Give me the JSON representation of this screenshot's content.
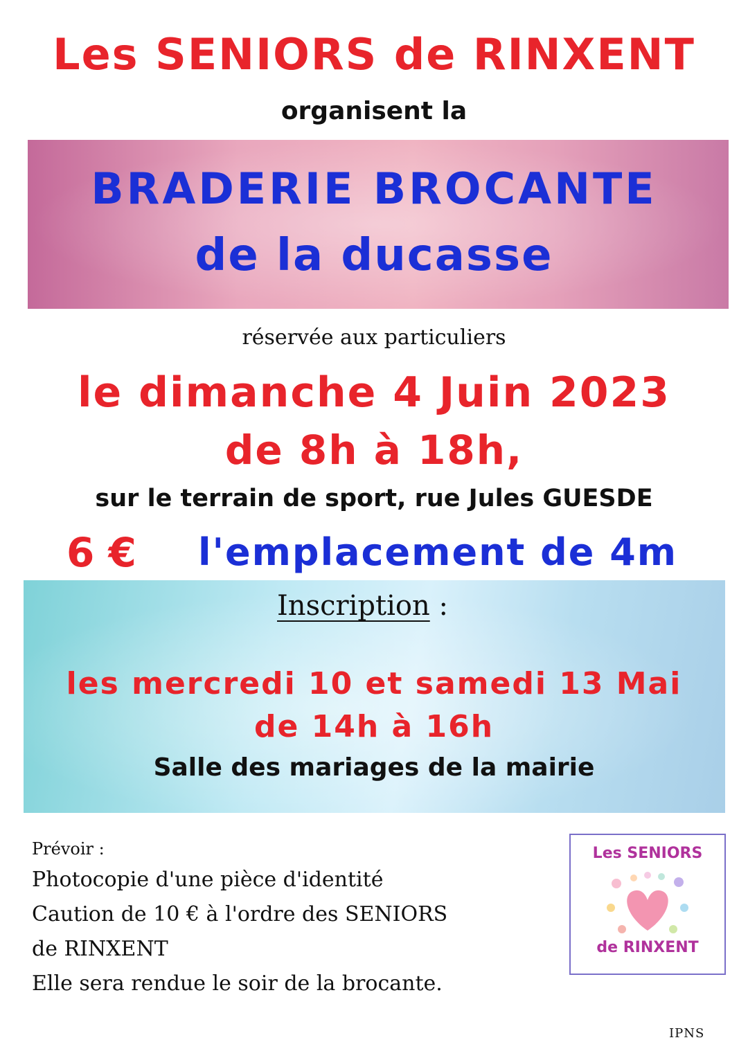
{
  "header": {
    "title": "Les SENIORS de RINXENT",
    "subtitle": "organisent la"
  },
  "banner": {
    "line1": "BRADERIE  BROCANTE",
    "line2": "de la ducasse"
  },
  "event": {
    "reserved": "réservée aux particuliers",
    "date": "le dimanche 4 Juin 2023",
    "hours": "de 8h à 18h,",
    "location": "sur le terrain de sport, rue Jules GUESDE",
    "price": "6 €",
    "spot": "l'emplacement de 4m"
  },
  "inscription": {
    "heading": "Inscription",
    "colon": " :",
    "dates": "les mercredi 10 et samedi 13 Mai",
    "hours": "de 14h à 16h",
    "place": "Salle des mariages de la mairie"
  },
  "prevoir": {
    "title": "Prévoir :",
    "lines": [
      "Photocopie d'une pièce d'identité",
      "Caution de 10 € à l'ordre des SENIORS",
      "de RINXENT",
      "Elle sera rendue le soir de la brocante."
    ]
  },
  "logo": {
    "top_text": "Les SENIORS",
    "bottom_text": "de RINXENT"
  },
  "footer": {
    "ipns": "IPNS"
  },
  "colors": {
    "red": "#e8242b",
    "blue": "#1b2fd6",
    "pink_banner": "#e9a7bd",
    "blue_banner": "#bfe9f4",
    "logo_text": "#b0329c"
  }
}
